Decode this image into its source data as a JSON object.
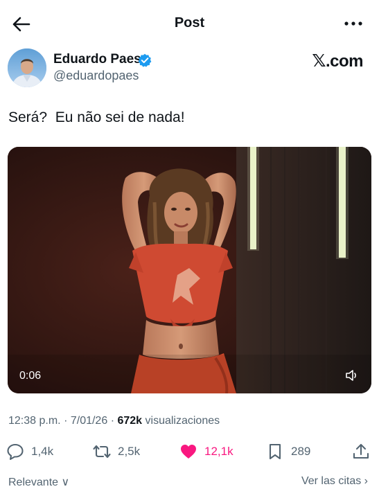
{
  "header": {
    "title": "Post",
    "back_icon": "arrow-left-icon",
    "more_icon": "more-horizontal-icon"
  },
  "author": {
    "name": "Eduardo Paes",
    "handle": "@eduardopaes",
    "verified_color": "#1d9bf0",
    "source": ".com"
  },
  "tweet": {
    "text": "Será?  Eu não sei de nada!"
  },
  "media": {
    "type": "video",
    "time": "0:06",
    "volume_icon": "speaker-icon"
  },
  "meta": {
    "time": "12:38 p.m.",
    "separator": "·",
    "date": "7/01/26",
    "views_count": "672k",
    "views_label": "visualizaciones"
  },
  "actions": {
    "replies": "1,4k",
    "reposts": "2,5k",
    "likes": "12,1k",
    "bookmarks": "289"
  },
  "footer": {
    "left": "Relevante ∨",
    "right": "Ver las citas ›"
  },
  "colors": {
    "like": "#f91880",
    "secondary_text": "#536471"
  }
}
